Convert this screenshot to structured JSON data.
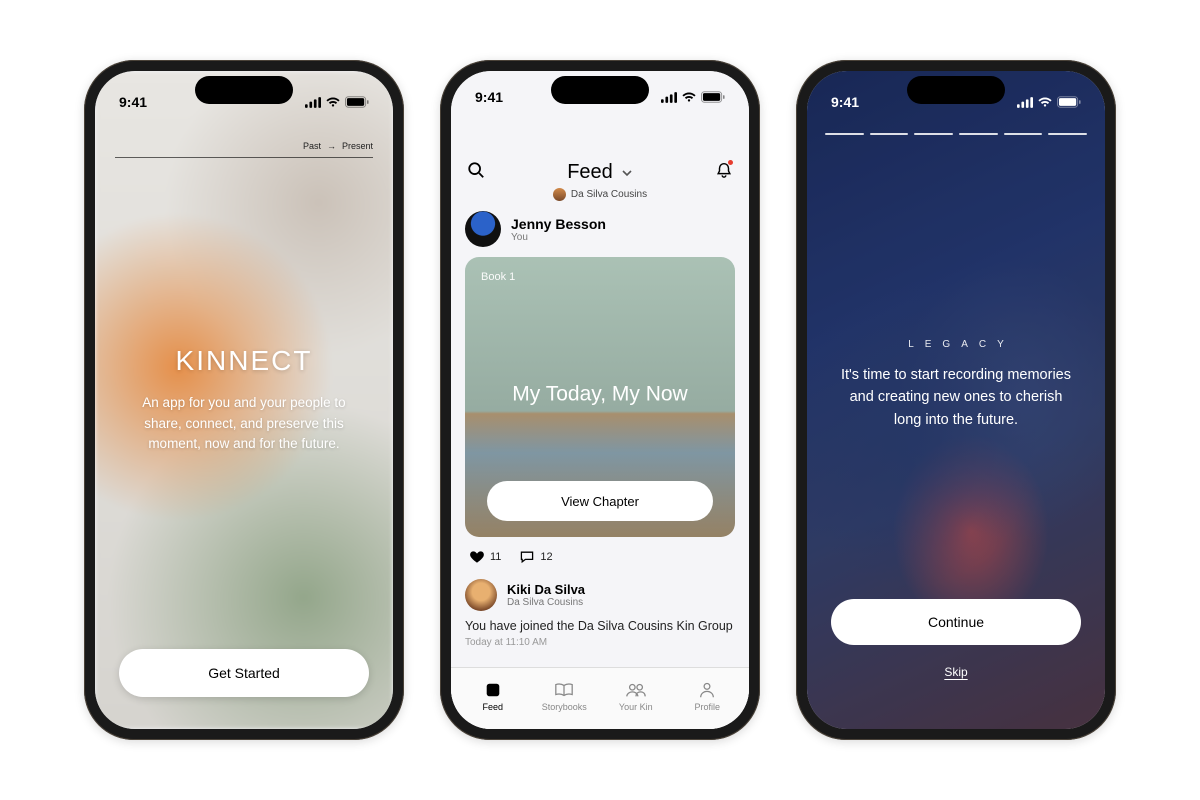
{
  "status": {
    "time": "9:41"
  },
  "splash": {
    "top_left": "Past",
    "top_right": "Present",
    "title": "KINNECT",
    "subtitle": "An app for you and your people to share, connect, and preserve this moment, now and for the future.",
    "cta": "Get Started"
  },
  "feed": {
    "title": "Feed",
    "subtitle_group": "Da Silva Cousins",
    "post1": {
      "author": "Jenny Besson",
      "relation": "You",
      "book_label": "Book 1",
      "card_title": "My Today, My Now",
      "card_cta": "View Chapter",
      "likes": "11",
      "comments": "12"
    },
    "post2": {
      "author": "Kiki Da Silva",
      "relation": "Da Silva Cousins",
      "text": "You have joined the Da Silva Cousins Kin Group",
      "time": "Today at 11:10 AM"
    },
    "tabs": {
      "feed": "Feed",
      "storybooks": "Storybooks",
      "yourkin": "Your Kin",
      "profile": "Profile"
    }
  },
  "onboard": {
    "segments": 6,
    "eyebrow": "LEGACY",
    "text": "It's time to start recording memories and creating new ones to cherish long into the future.",
    "cta": "Continue",
    "skip": "Skip"
  }
}
